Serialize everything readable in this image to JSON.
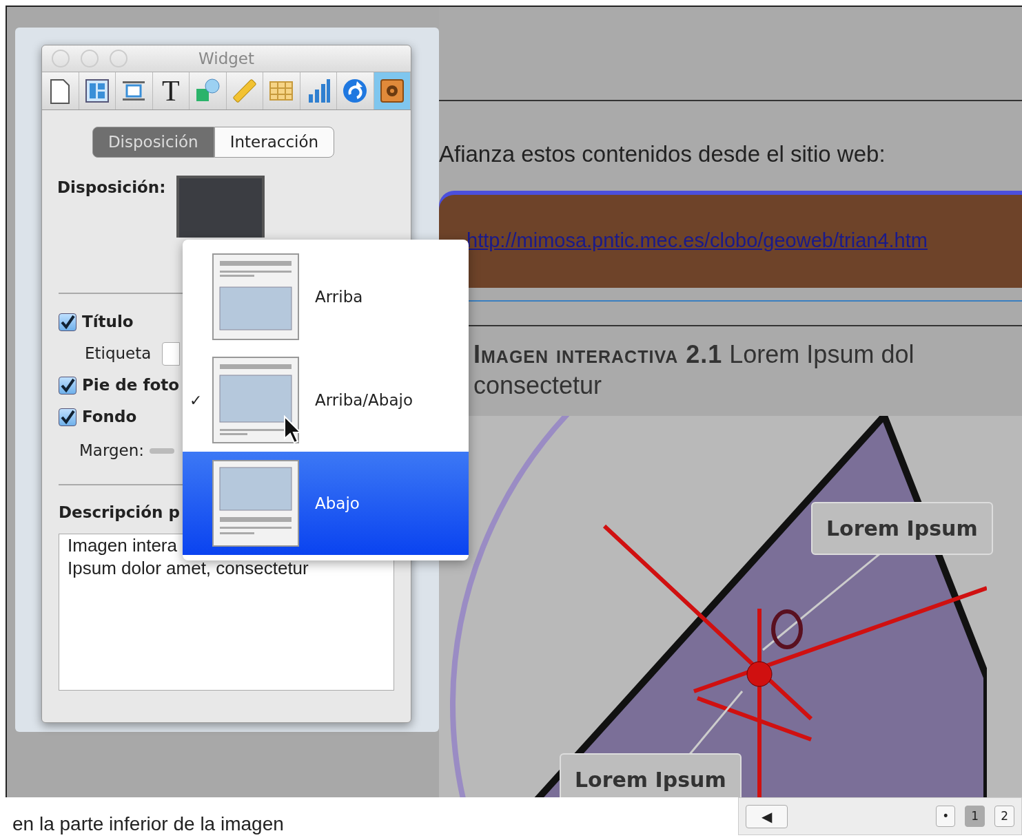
{
  "widget_window": {
    "title": "Widget",
    "toolbar": [
      {
        "kind": "page",
        "selected": false
      },
      {
        "kind": "columns",
        "selected": false
      },
      {
        "kind": "media",
        "selected": false
      },
      {
        "kind": "text",
        "label": "T",
        "selected": false
      },
      {
        "kind": "shapes",
        "selected": false
      },
      {
        "kind": "ruler",
        "selected": false
      },
      {
        "kind": "table",
        "selected": false
      },
      {
        "kind": "chart",
        "selected": false
      },
      {
        "kind": "refresh",
        "selected": false
      },
      {
        "kind": "gear",
        "selected": true
      }
    ],
    "tabs": [
      {
        "label": "Disposición",
        "selected": true
      },
      {
        "label": "Interacción",
        "selected": false
      }
    ],
    "layout_label": "Disposición:",
    "options": [
      {
        "label": "Título",
        "checked": true
      },
      {
        "label": "Pie de foto",
        "checked": true
      },
      {
        "label": "Fondo",
        "checked": true
      }
    ],
    "tag_label": "Etiqueta",
    "margin_label": "Margen:",
    "description_label": "Descripción p",
    "description_lines": [
      "Imagen intera",
      "Ipsum dolor amet, consectetur"
    ]
  },
  "layout_menu": {
    "items": [
      {
        "label": "Arriba",
        "kind": "top",
        "checked": false,
        "selected": false
      },
      {
        "label": "Arriba/Abajo",
        "kind": "both",
        "checked": true,
        "selected": false
      },
      {
        "label": "Abajo",
        "kind": "bottom",
        "checked": false,
        "selected": true
      }
    ],
    "check_mark": "✓"
  },
  "document": {
    "intro": "Afianza estos contenidos desde el sitio web:",
    "link": "http://mimosa.pntic.mec.es/clobo/geoweb/trian4.htm",
    "caption_label": "Imagen interactiva 2.1",
    "caption_text": " Lorem Ipsum dol consectetur",
    "callouts": [
      "Lorem Ipsum",
      "Lorem Ipsum"
    ]
  },
  "footer": {
    "text": "en la parte inferior de la imagen",
    "pager": [
      {
        "label": "◀",
        "kind": "back",
        "selected": false
      },
      {
        "label": "•",
        "kind": "dot",
        "selected": false
      },
      {
        "label": "1",
        "kind": "page",
        "selected": true
      },
      {
        "label": "2",
        "kind": "page",
        "selected": false
      }
    ]
  }
}
